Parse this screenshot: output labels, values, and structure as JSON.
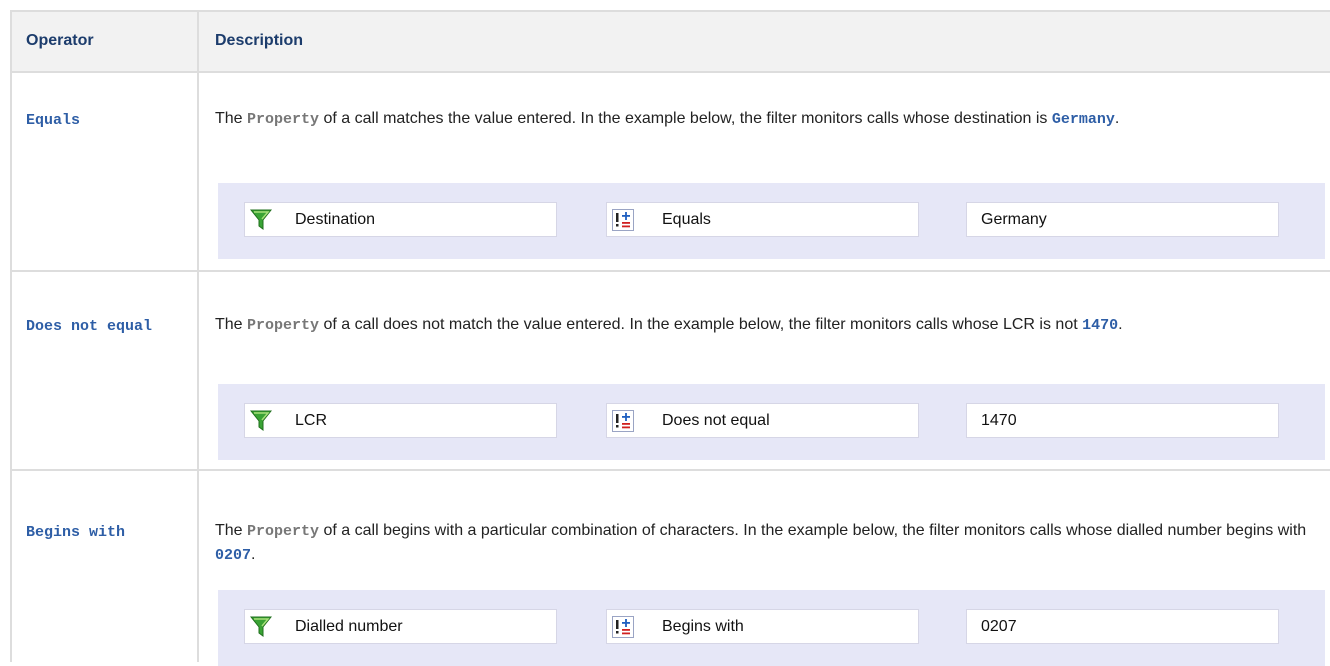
{
  "header": {
    "operator": "Operator",
    "description": "Description"
  },
  "rows": [
    {
      "operator": "Equals",
      "desc_prefix": "The ",
      "desc_property": "Property",
      "desc_mid": " of a call matches the value entered. In the example below, the filter monitors calls whose destination is ",
      "desc_value": "Germany",
      "desc_suffix": ".",
      "example": {
        "property": "Destination",
        "operator": "Equals",
        "value": "Germany"
      }
    },
    {
      "operator": "Does not equal",
      "desc_prefix": "The ",
      "desc_property": "Property",
      "desc_mid": " of a call does not match the value entered. In the example below, the filter monitors calls whose LCR is not ",
      "desc_value": "1470",
      "desc_suffix": ".",
      "example": {
        "property": "LCR",
        "operator": "Does not equal",
        "value": "1470"
      }
    },
    {
      "operator": "Begins with",
      "desc_prefix": "The ",
      "desc_property": "Property",
      "desc_mid": " of a call begins with a particular combination of characters. In the example below, the filter monitors calls whose dialled number begins with ",
      "desc_value": "0207",
      "desc_suffix": ".",
      "example": {
        "property": "Dialled number",
        "operator": "Begins with",
        "value": "0207"
      }
    }
  ],
  "icons": {
    "property_field": "filter-funnel-icon",
    "operator_field": "operator-icon"
  },
  "colors": {
    "header_bg": "#f2f2f2",
    "example_bg": "#e6e7f7",
    "accent": "#2e5ea6",
    "funnel": "#3aa335"
  }
}
